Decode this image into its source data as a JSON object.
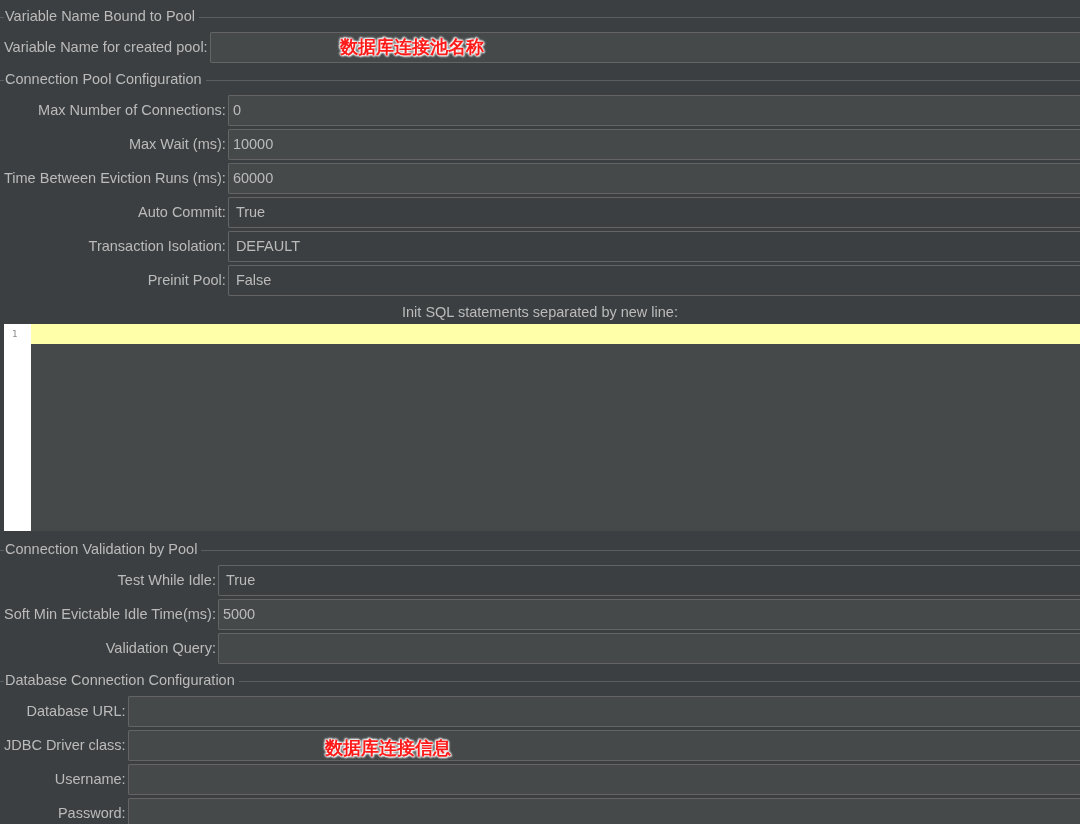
{
  "sections": [
    {
      "title": "Variable Name Bound to Pool",
      "fields": [
        {
          "label": "Variable Name for created pool:",
          "kind": "text",
          "annotation": "数据库连接池名称"
        }
      ]
    },
    {
      "title": "Connection Pool Configuration",
      "fields": [
        {
          "label": "Max Number of Connections:",
          "kind": "text",
          "value": "0"
        },
        {
          "label": "Max Wait (ms):",
          "kind": "text",
          "value": "10000"
        },
        {
          "label": "Time Between Eviction Runs (ms):",
          "kind": "text",
          "value": "60000"
        },
        {
          "label": "Auto Commit:",
          "kind": "combo",
          "value": "True"
        },
        {
          "label": "Transaction Isolation:",
          "kind": "combo",
          "value": "DEFAULT"
        },
        {
          "label": "Preinit Pool:",
          "kind": "combo",
          "value": "False"
        }
      ],
      "init_sql": {
        "label": "Init SQL statements separated by new line:",
        "lines": [
          {
            "number": "1",
            "current": true
          }
        ]
      }
    },
    {
      "title": "Connection Validation by Pool",
      "fields": [
        {
          "label": "Test While Idle:",
          "kind": "combo",
          "value": "True"
        },
        {
          "label": "Soft Min Evictable Idle Time(ms):",
          "kind": "text",
          "value": "5000"
        },
        {
          "label": "Validation Query:",
          "kind": "text"
        }
      ]
    },
    {
      "title": "Database Connection Configuration",
      "fields": [
        {
          "label": "Database URL:",
          "kind": "text"
        },
        {
          "label": "JDBC Driver class:",
          "kind": "text",
          "annotation": "数据库连接信息"
        },
        {
          "label": "Username:",
          "kind": "text"
        },
        {
          "label": "Password:",
          "kind": "text"
        }
      ]
    }
  ]
}
